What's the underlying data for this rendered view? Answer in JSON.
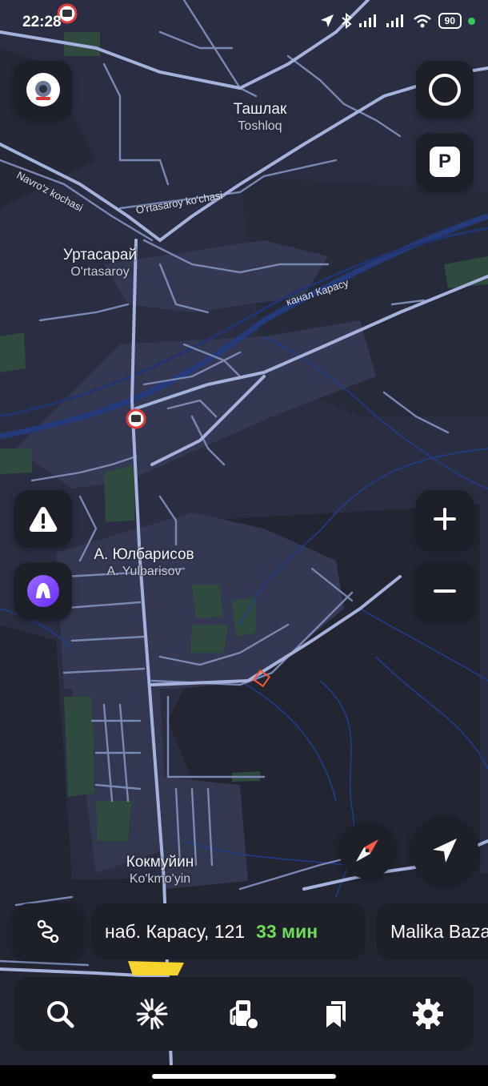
{
  "status_bar": {
    "time": "22:28",
    "battery": "90"
  },
  "map": {
    "places": [
      {
        "name": "Ташлак",
        "latin": "Toshloq"
      },
      {
        "name": "Уртасарай",
        "latin": "O'rtasaroy"
      },
      {
        "name": "А. Юлбарисов",
        "latin": "A. Yulbarisov"
      },
      {
        "name": "Кокмуйин",
        "latin": "Ko'kmo'yin"
      }
    ],
    "roads": {
      "navroz": "Navro'z kochasi",
      "ortasaroy": "O'rtasaroy ko'chasi",
      "canal": "канал Карасу"
    }
  },
  "route_card": {
    "address": "наб. Карасу, 121",
    "eta": "33 мин"
  },
  "route_card_next": {
    "address": "Malika Bazaar"
  },
  "icons": {
    "avatar": "avatar-icon",
    "layers": "layers-icon",
    "parking": "parking-icon",
    "warning": "warning-icon",
    "alice": "voice-assistant-icon",
    "zoom_in": "plus-icon",
    "zoom_out": "minus-icon",
    "compass": "compass-icon",
    "locate": "navigation-arrow-icon",
    "route": "route-icon",
    "search": "search-icon",
    "discover": "discover-icon",
    "fuel": "fuel-icon",
    "bookmarks": "bookmarks-icon",
    "settings": "gear-icon"
  },
  "parking_label": "P"
}
